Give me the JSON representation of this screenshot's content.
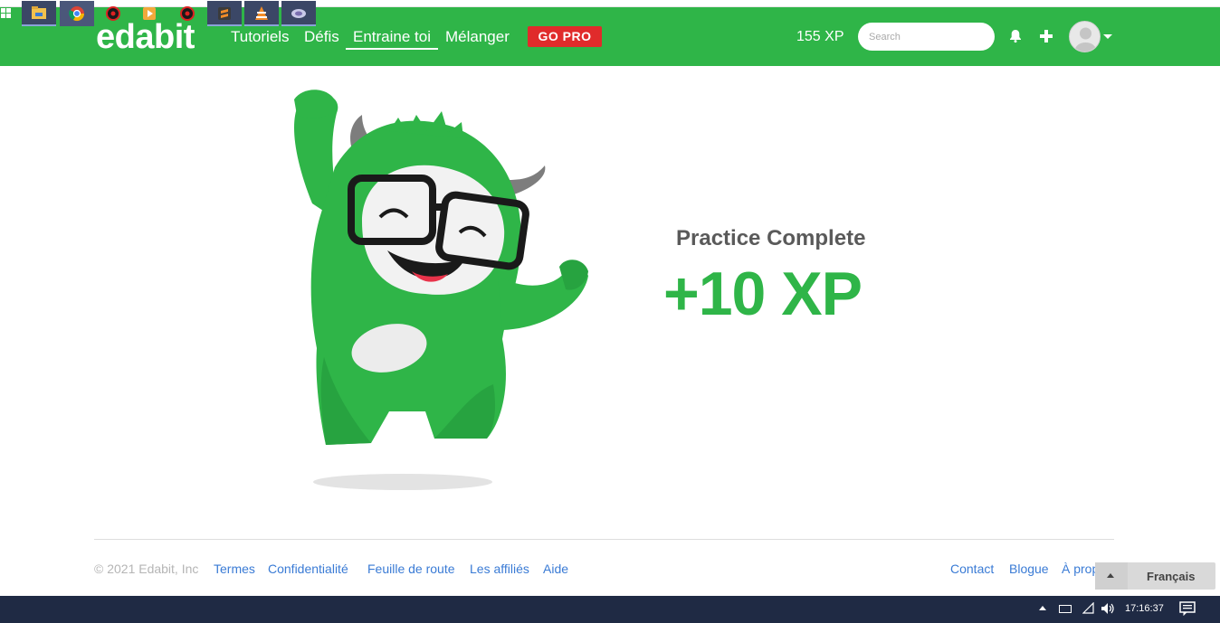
{
  "app": {
    "logo": "edabit",
    "nav": [
      {
        "label": "Tutoriels",
        "active": false
      },
      {
        "label": "Défis",
        "active": false
      },
      {
        "label": "Entraine toi",
        "active": true
      },
      {
        "label": "Mélanger",
        "active": false
      }
    ],
    "gopro_label": "GO PRO",
    "xp": "155 XP",
    "search_placeholder": "Search",
    "icons": [
      "bell-icon",
      "plus-icon",
      "avatar",
      "chevron-down-icon"
    ]
  },
  "result": {
    "title": "Practice Complete",
    "xp_gain": "+10 XP"
  },
  "footer": {
    "copyright": "© 2021 Edabit, Inc",
    "links_left": [
      "Termes",
      "Confidentialité",
      "Feuille de route",
      "Les affiliés",
      "Aide"
    ],
    "links_right": [
      "Contact",
      "Blogue",
      "À prop"
    ],
    "language": "Français"
  },
  "taskbar": {
    "time": "17:16:37",
    "apps": [
      "windows-start-icon",
      "file-explorer-icon",
      "chrome-icon",
      "media-app-icon",
      "media-player-icon",
      "media-app-icon",
      "sublime-text-icon",
      "vlc-icon",
      "app-icon"
    ]
  },
  "colors": {
    "brand_green": "#2fb548",
    "gopro_red": "#e02b2b",
    "link_blue": "#3a7bd5",
    "taskbar": "#1f2a44"
  }
}
